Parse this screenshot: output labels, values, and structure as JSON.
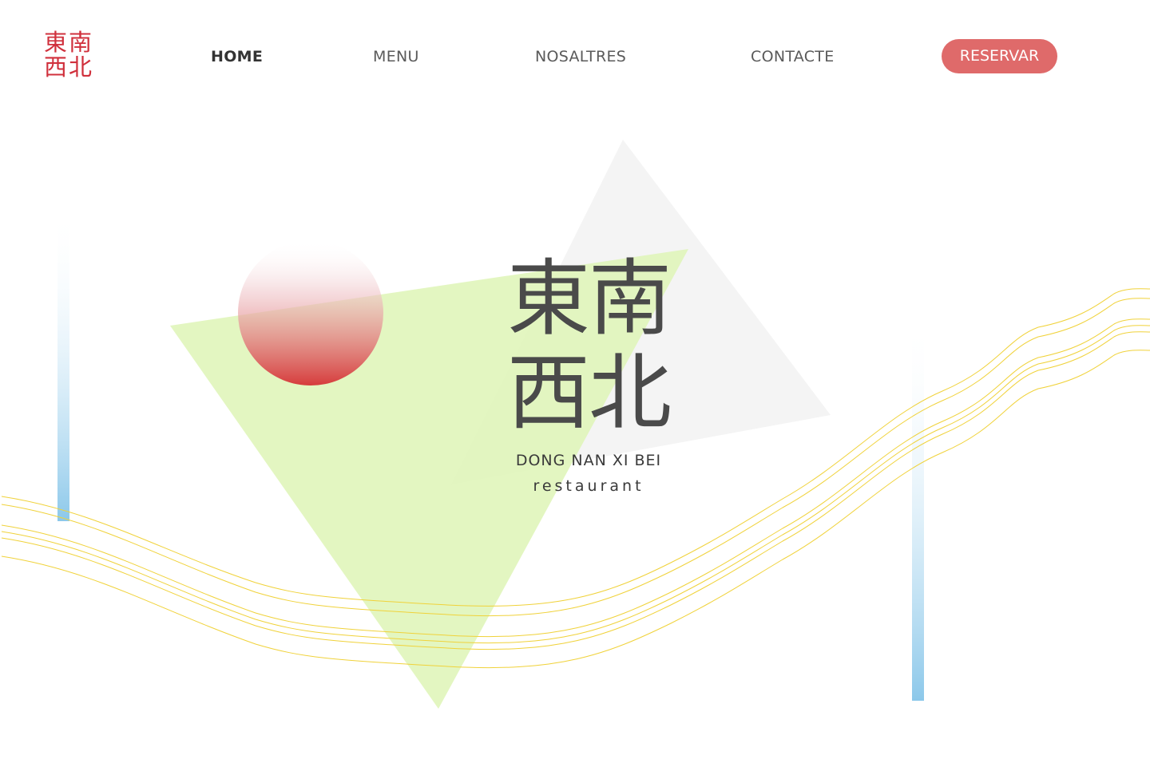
{
  "logo": {
    "line1": "東南",
    "line2": "西北",
    "color": "#d0303c"
  },
  "nav": {
    "items": [
      {
        "label": "HOME",
        "active": true
      },
      {
        "label": "MENU",
        "active": false
      },
      {
        "label": "NOSALTRES",
        "active": false
      },
      {
        "label": "CONTACTE",
        "active": false
      }
    ],
    "reserve_label": "RESERVAR",
    "reserve_color": "#df6a6a"
  },
  "hero": {
    "title_line1": "東南",
    "title_line2": "西北",
    "subtitle": "DONG NAN XI BEI",
    "tagline": "restaurant"
  },
  "colors": {
    "green_triangle": "#e3f6c0",
    "grey_triangle": "#f5f5f5",
    "sun_red": "#d84040",
    "bar_blue": "#8cc8ea",
    "wave_yellow": "#f2d94a"
  }
}
